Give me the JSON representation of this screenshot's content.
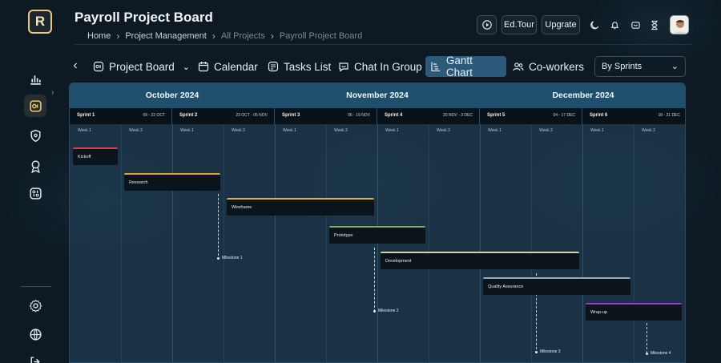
{
  "app": {
    "logo_text": "R"
  },
  "header": {
    "title": "Payroll Project Board",
    "breadcrumb": [
      "Home",
      "Project Management",
      "All Projects",
      "Payroll Project Board"
    ],
    "ed_tour_label": "Ed.Tour",
    "upgrade_label": "Upgrate"
  },
  "tabs": [
    {
      "label": "Project Board",
      "icon": "board-icon"
    },
    {
      "label": "Calendar",
      "icon": "calendar-icon"
    },
    {
      "label": "Tasks List",
      "icon": "tasks-icon"
    },
    {
      "label": "Chat In Group",
      "icon": "chat-icon"
    },
    {
      "label": "Gantt Chart",
      "icon": "gantt-icon",
      "active": true
    },
    {
      "label": "Co-workers",
      "icon": "users-icon"
    }
  ],
  "view_select": {
    "value": "By Sprints"
  },
  "gantt": {
    "months": [
      "October 2024",
      "November 2024",
      "December 2024"
    ],
    "sprints": [
      {
        "name": "Sprint 1",
        "dates": "09 - 22 OCT"
      },
      {
        "name": "Sprint 2",
        "dates": "23 OCT - 05 NOV"
      },
      {
        "name": "Sprint 3",
        "dates": "06 - 19 NOV"
      },
      {
        "name": "Sprint 4",
        "dates": "20 NOV - 3 DEC"
      },
      {
        "name": "Sprint 5",
        "dates": "04 - 17 DEC"
      },
      {
        "name": "Sprint 6",
        "dates": "18 - 31 DEC"
      }
    ],
    "week_labels": [
      "Week 1",
      "Week 2"
    ],
    "tasks": [
      {
        "label": "Kickoff",
        "color": "#d9404a"
      },
      {
        "label": "Research",
        "color": "#e0a235"
      },
      {
        "label": "Wireframe",
        "color": "#e3b236"
      },
      {
        "label": "Prototype",
        "color": "#7fa86a"
      },
      {
        "label": "Development",
        "color": "#d8cfa6"
      },
      {
        "label": "Quality Assurance",
        "color": "#9aa9b6"
      },
      {
        "label": "Wrap-up",
        "color": "#9a3bd6"
      }
    ],
    "milestones": [
      "Milestone 1",
      "Milestone 2",
      "Milestone 3",
      "Milestone 4"
    ]
  }
}
